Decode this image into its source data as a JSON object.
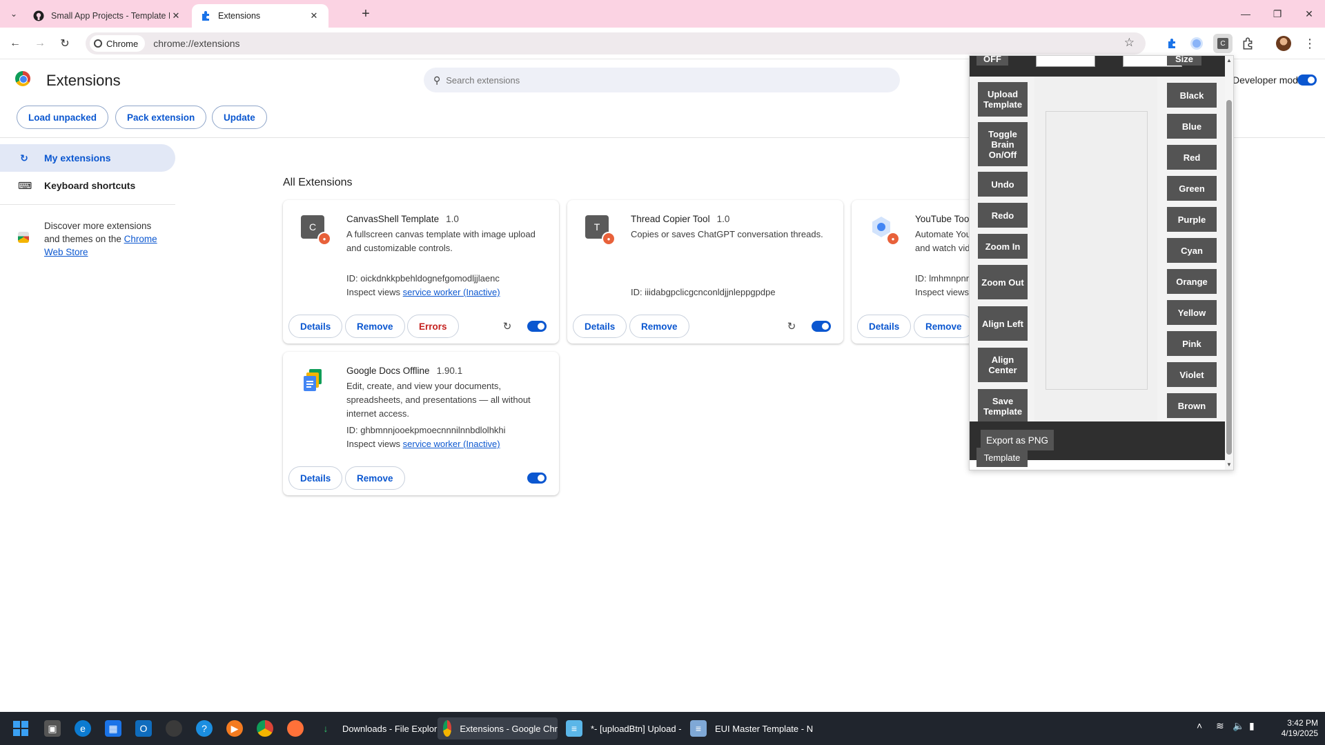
{
  "tabs": [
    {
      "title": "Small App Projects - Template Bui",
      "icon": "github-icon"
    },
    {
      "title": "Extensions",
      "icon": "puzzle-icon"
    }
  ],
  "toolbar": {
    "chip_label": "Chrome",
    "url": "chrome://extensions"
  },
  "header": {
    "title": "Extensions",
    "search_placeholder": "Search extensions",
    "devmode_label": "Developer mode",
    "devmode_on": true,
    "buttons": [
      "Load unpacked",
      "Pack extension",
      "Update"
    ]
  },
  "sidebar": {
    "items": [
      {
        "label": "My extensions",
        "icon": "extensions-icon",
        "active": true
      },
      {
        "label": "Keyboard shortcuts",
        "icon": "keyboard-icon",
        "active": false
      }
    ],
    "discover_text": "Discover more extensions and themes on the",
    "store_link": "Chrome Web Store"
  },
  "main": {
    "section_title": "All Extensions",
    "extensions": [
      {
        "name": "CanvasShell Template",
        "version": "1.0",
        "icon_letter": "C",
        "description": "A fullscreen canvas template with image upload and customizable controls.",
        "id": "ID: oickdnkkpbehldognefgomodljjlaenc",
        "inspect_label": "Inspect views",
        "inspect_link": "service worker (Inactive)",
        "buttons": [
          "Details",
          "Remove",
          "Errors"
        ],
        "enabled": true
      },
      {
        "name": "Thread Copier Tool",
        "version": "1.0",
        "icon_letter": "T",
        "description": "Copies or saves ChatGPT conversation threads.",
        "id": "ID: iiidabgpclicgcnconldjjnleppgpdpe",
        "buttons": [
          "Details",
          "Remove"
        ],
        "enabled": true
      },
      {
        "name": "YouTube Tooll",
        "version": "",
        "description": "Automate You and watch vid",
        "id": "ID: lmhmnpnr",
        "inspect_label": "Inspect views",
        "buttons": [
          "Details",
          "Remove"
        ]
      },
      {
        "name": "Google Docs Offline",
        "version": "1.90.1",
        "description": "Edit, create, and view your documents, spreadsheets, and presentations — all without internet access.",
        "id": "ID: ghbmnnjooekpmoecnnnilnnbdlolhkhi",
        "inspect_label": "Inspect views",
        "inspect_link": "service worker (Inactive)",
        "buttons": [
          "Details",
          "Remove"
        ],
        "enabled": true
      }
    ]
  },
  "popup": {
    "top_off": "OFF",
    "top_size": "Size",
    "left_buttons": [
      "Upload Template",
      "Toggle Brain On/Off",
      "Undo",
      "Redo",
      "Zoom In",
      "Zoom Out",
      "Align Left",
      "Align Center",
      "Save Template"
    ],
    "color_buttons": [
      "Black",
      "Blue",
      "Red",
      "Green",
      "Purple",
      "Cyan",
      "Orange",
      "Yellow",
      "Pink",
      "Violet",
      "Brown"
    ],
    "export_label": "Export as PNG",
    "template_label": "Template"
  },
  "taskbar": {
    "apps": [
      {
        "label": "Downloads - File Explor"
      },
      {
        "label": "Extensions - Google Chr"
      },
      {
        "label": "*- [uploadBtn] Upload -"
      },
      {
        "label": "EUI Master Template - N"
      }
    ],
    "time": "3:42 PM",
    "date": "4/19/2025"
  },
  "colors": {
    "tabstrip": "#fbd3e3",
    "accent": "#0b57d0",
    "error": "#c5221f",
    "popup_dark": "#2f2f2f",
    "popup_button": "#545454",
    "taskbar": "#20252d"
  }
}
